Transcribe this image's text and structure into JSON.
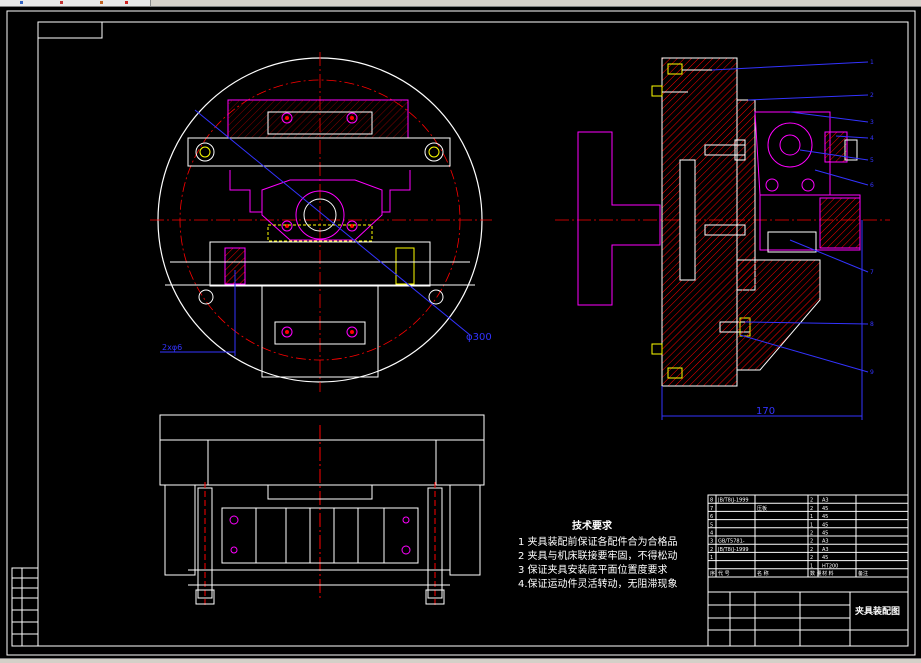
{
  "drawing": {
    "title_block_name": "夹具装配图",
    "tech_requirements": {
      "heading": "技术要求",
      "items": [
        "1  夹具装配前保证各配件合为合格品",
        "2  夹具与机床联接要牢固，不得松动",
        "3  保证夹具安装底平面位置度要求",
        "4.保证运动件灵活转动，无阻滞现象"
      ]
    },
    "dimensions": {
      "diameter": "φ300",
      "width": "170",
      "holes": "2xφ6"
    },
    "balloons": [
      "1",
      "2",
      "3",
      "4",
      "5",
      "6",
      "7",
      "8",
      "9"
    ],
    "parts_table": {
      "rows": [
        {
          "no": "8",
          "code": "JB/T8(J-1999",
          "name": "",
          "qty": "2",
          "mat": "A3"
        },
        {
          "no": "7",
          "code": "",
          "name": "压板",
          "qty": "2",
          "mat": "45"
        },
        {
          "no": "6",
          "code": "",
          "name": "",
          "qty": "1",
          "mat": "45"
        },
        {
          "no": "5",
          "code": "",
          "name": "",
          "qty": "1",
          "mat": "45"
        },
        {
          "no": "4",
          "code": "",
          "name": "",
          "qty": "2",
          "mat": "45"
        },
        {
          "no": "3",
          "code": "GB/T5781-",
          "name": "",
          "qty": "2",
          "mat": "A3"
        },
        {
          "no": "2",
          "code": "JB/T8(J-1999",
          "name": "",
          "qty": "2",
          "mat": "A3"
        },
        {
          "no": "1",
          "code": "",
          "name": "",
          "qty": "2",
          "mat": "45"
        },
        {
          "no": "",
          "code": "",
          "name": "",
          "qty": "1",
          "mat": "HT200"
        }
      ],
      "header": [
        "序",
        "代 号",
        "名 称",
        "数 量",
        "材 料",
        "备注"
      ]
    }
  },
  "colors": {
    "background": "#000000",
    "outline": "#ffffff",
    "section": "#ff0000",
    "part": "#ff00ff",
    "dimension": "#3333ff",
    "yellow": "#ffff00"
  }
}
